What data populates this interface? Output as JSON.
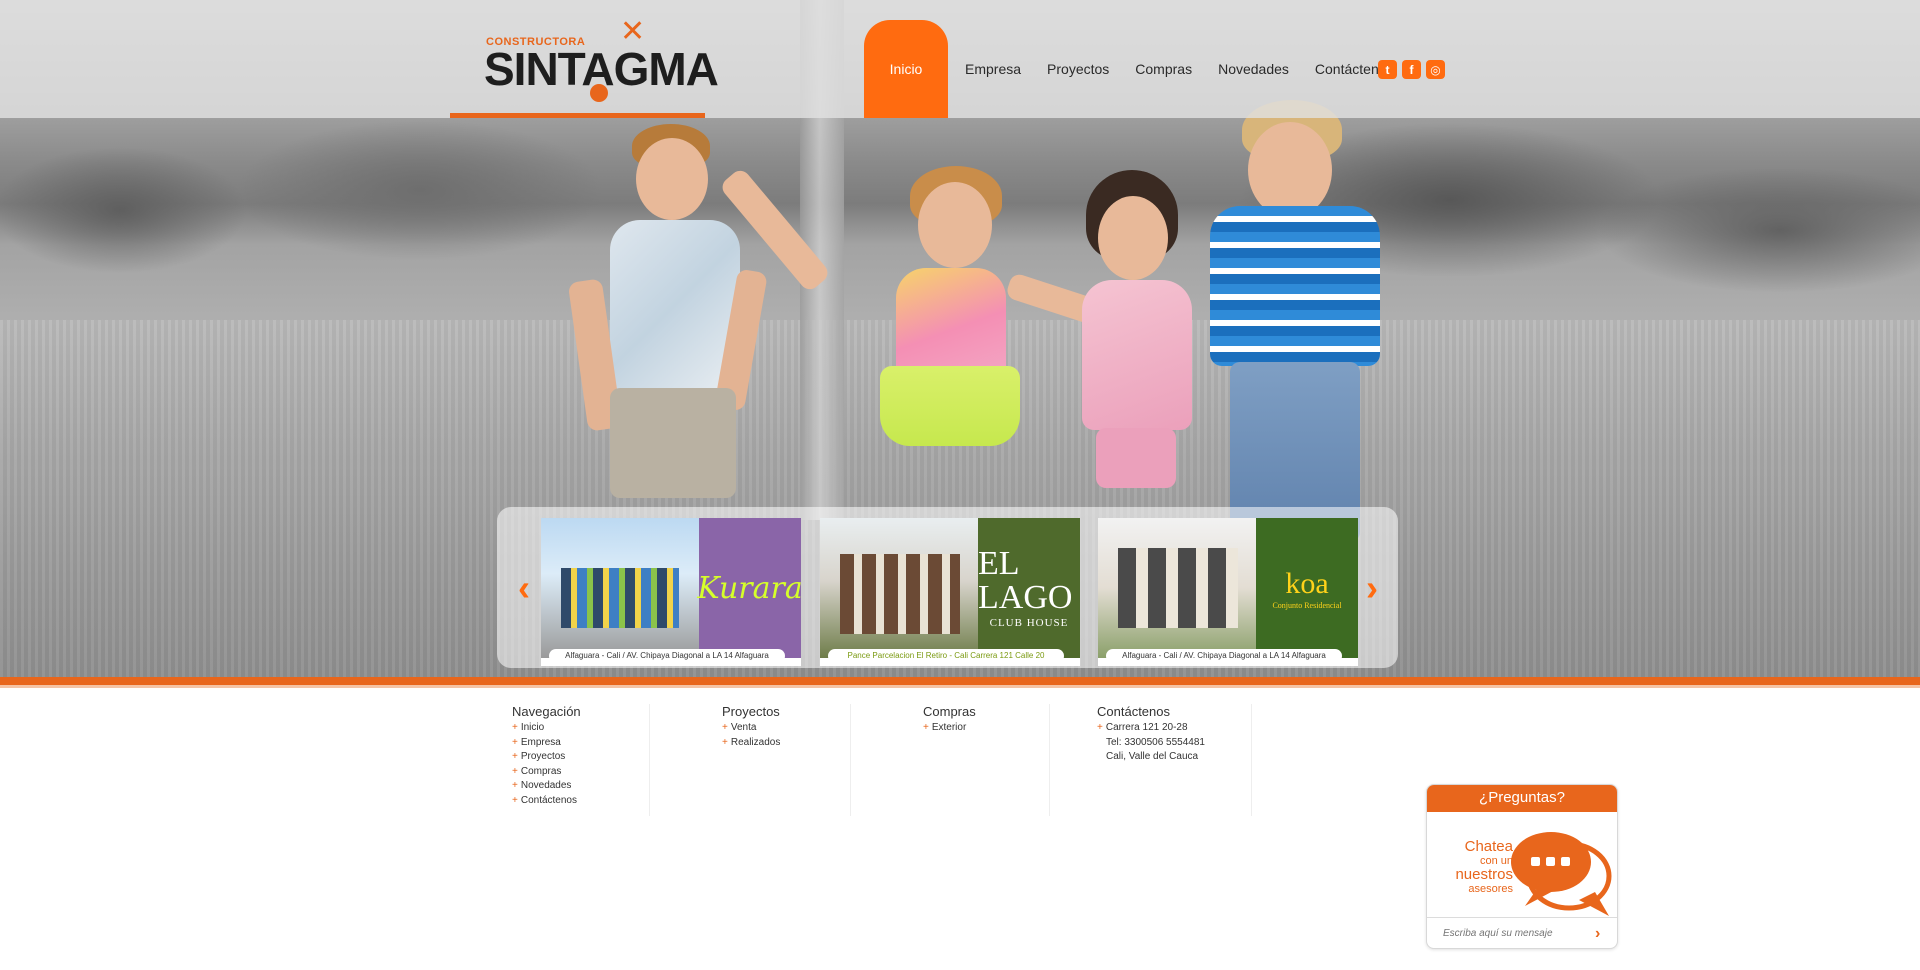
{
  "header": {
    "logo": {
      "small": "CONSTRUCTORA",
      "big": "SINTAGMA",
      "alt": "Constructora Sintagma"
    },
    "nav": [
      {
        "label": "Inicio",
        "active": true
      },
      {
        "label": "Empresa",
        "active": false
      },
      {
        "label": "Proyectos",
        "active": false
      },
      {
        "label": "Compras",
        "active": false
      },
      {
        "label": "Novedades",
        "active": false
      },
      {
        "label": "Contáctenos",
        "active": false
      }
    ],
    "social": [
      {
        "name": "twitter-icon",
        "glyph": "t"
      },
      {
        "name": "facebook-icon",
        "glyph": "f"
      },
      {
        "name": "instagram-icon",
        "glyph": "◎"
      }
    ]
  },
  "carousel": {
    "prev_glyph": "‹",
    "next_glyph": "›",
    "items": [
      {
        "brand": "Kurara",
        "caption": "Alfaguara - Cali / AV. Chipaya Diagonal a  LA 14 Alfaguara"
      },
      {
        "brand_line1": "EL LAGO",
        "brand_line2": "CLUB HOUSE",
        "caption": "Pance Parcelacion El Retiro - Cali Carrera 121 Calle 20"
      },
      {
        "brand_line1": "koa",
        "brand_line2": "Conjunto Residencial",
        "badge": "koa",
        "caption": "Alfaguara - Cali / AV. Chipaya Diagonal a  LA 14 Alfaguara"
      }
    ]
  },
  "footer": {
    "navegacion": {
      "title": "Navegación",
      "items": [
        "Inicio",
        "Empresa",
        "Proyectos",
        "Compras",
        "Novedades",
        "Contáctenos"
      ]
    },
    "proyectos": {
      "title": "Proyectos",
      "items": [
        "Venta",
        "Realizados"
      ]
    },
    "compras": {
      "title": "Compras",
      "items": [
        "Exterior"
      ]
    },
    "contactenos": {
      "title": "Contáctenos",
      "address": "Carrera 121 20-28",
      "phone": "Tel: 3300506 5554481",
      "city": "Cali, Valle del Cauca"
    }
  },
  "chat": {
    "title": "¿Preguntas?",
    "line1": "Chatea",
    "line2": "con un",
    "line3": "nuestros",
    "line4": "asesores",
    "placeholder": "Escriba aquí su mensaje",
    "send_glyph": "›"
  },
  "colors": {
    "accent": "#e8661c",
    "nav_active": "#ff6b10"
  }
}
